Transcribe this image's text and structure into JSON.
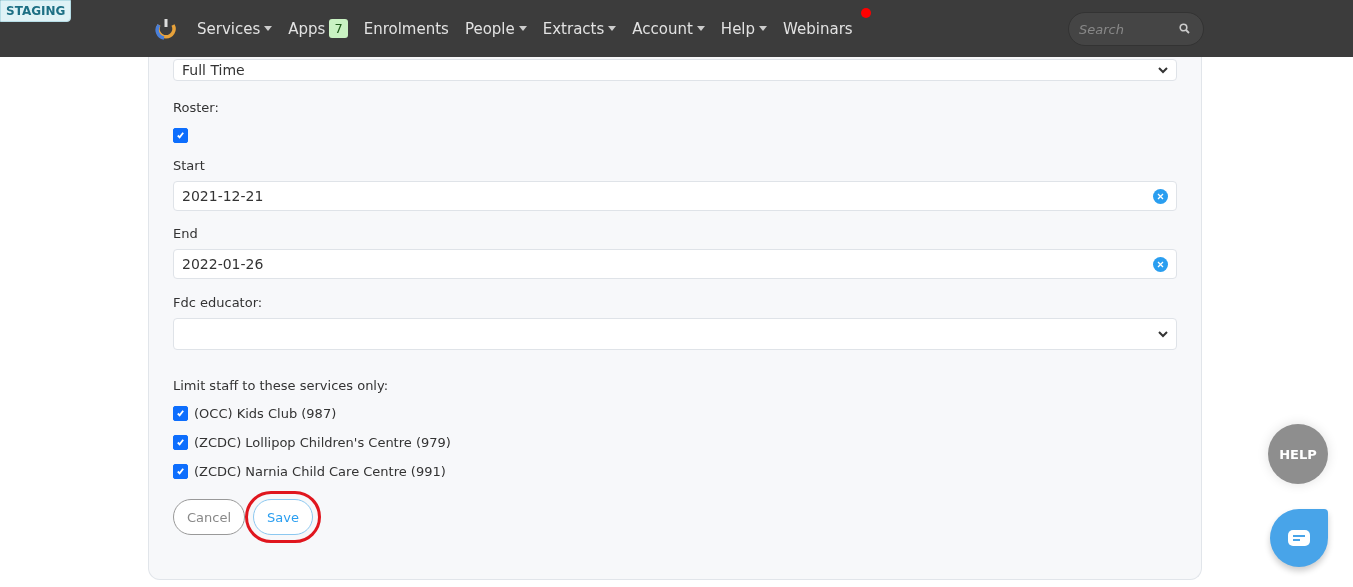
{
  "environment_badge": "STAGING",
  "nav": {
    "items": [
      {
        "label": "Services",
        "dropdown": true
      },
      {
        "label": "Apps",
        "dropdown": false,
        "badge": "7"
      },
      {
        "label": "Enrolments",
        "dropdown": false
      },
      {
        "label": "People",
        "dropdown": true
      },
      {
        "label": "Extracts",
        "dropdown": true
      },
      {
        "label": "Account",
        "dropdown": true
      },
      {
        "label": "Help",
        "dropdown": true
      },
      {
        "label": "Webinars",
        "dropdown": false,
        "notification": true
      }
    ],
    "search": {
      "placeholder": "Search"
    }
  },
  "form": {
    "category_value": "Full Time",
    "roster": {
      "label": "Roster:",
      "checked": true
    },
    "start": {
      "label": "Start",
      "value": "2021-12-21"
    },
    "end": {
      "label": "End",
      "value": "2022-01-26"
    },
    "fdc_educator": {
      "label": "Fdc educator:"
    },
    "services": {
      "label": "Limit staff to these services only:",
      "items": [
        {
          "label": "(OCC) Kids Club (987)",
          "checked": true
        },
        {
          "label": "(ZCDC) Lollipop Children's Centre (979)",
          "checked": true
        },
        {
          "label": "(ZCDC) Narnia Child Care Centre (991)",
          "checked": true
        }
      ]
    },
    "buttons": [
      {
        "label": "Cancel",
        "kind": "cancel",
        "highlighted": false
      },
      {
        "label": "Save",
        "kind": "save",
        "highlighted": true
      }
    ]
  },
  "help_button": "HELP"
}
